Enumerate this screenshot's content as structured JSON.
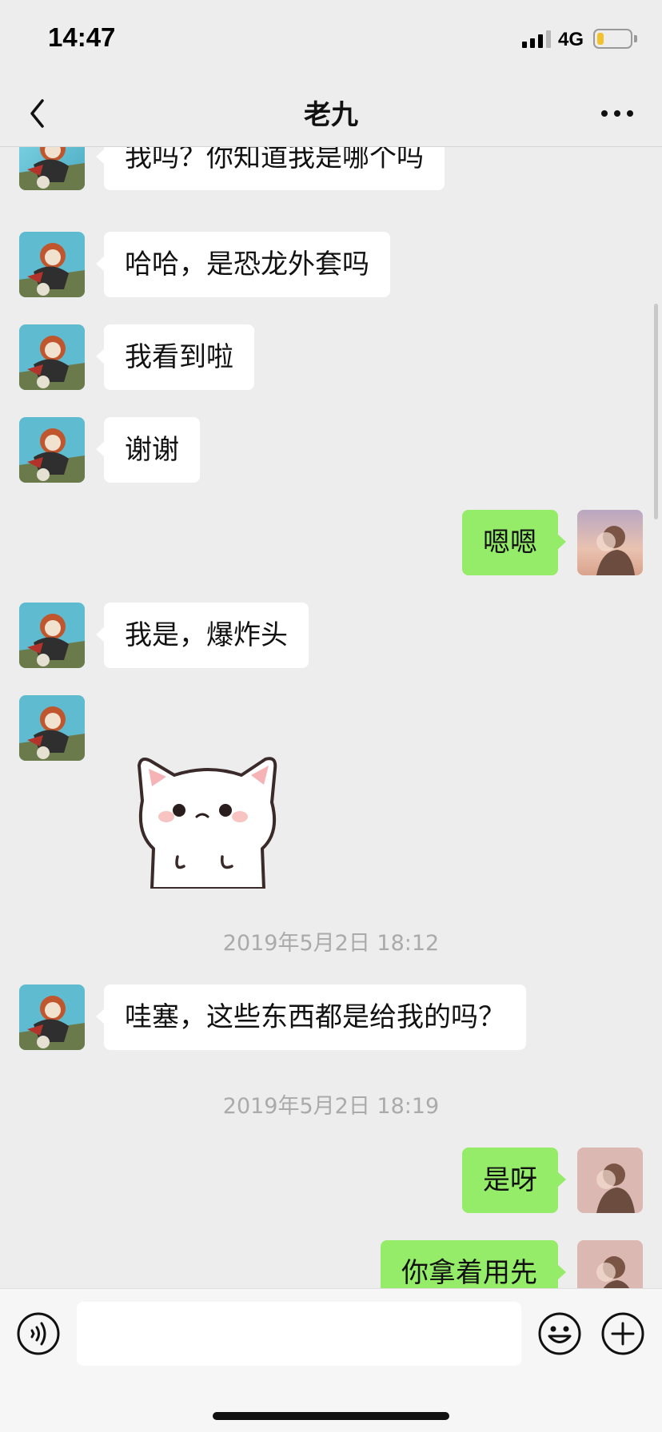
{
  "status_bar": {
    "time": "14:47",
    "network": "4G",
    "battery_level": 0.2,
    "battery_color": "#f2c22e"
  },
  "nav": {
    "title": "老九",
    "back_icon": "chevron-left-icon",
    "more_icon": "ellipsis-icon"
  },
  "colors": {
    "background": "#ededed",
    "incoming_bubble": "#ffffff",
    "outgoing_bubble": "#95ec69",
    "timestamp_text": "#aaaaaa"
  },
  "messages": [
    {
      "direction": "in",
      "text": "我吗？你知道我是哪个吗"
    },
    {
      "direction": "in",
      "text": "哈哈，是恐龙外套吗"
    },
    {
      "direction": "in",
      "text": "我看到啦"
    },
    {
      "direction": "in",
      "text": "谢谢"
    },
    {
      "direction": "out",
      "text": "嗯嗯"
    },
    {
      "direction": "in",
      "text": "我是，爆炸头"
    },
    {
      "direction": "in",
      "type": "sticker",
      "sticker": "white-cat-sticker"
    },
    {
      "type": "timestamp",
      "text": "2019年5月2日 18:12"
    },
    {
      "direction": "in",
      "text": "哇塞，这些东西都是给我的吗？"
    },
    {
      "type": "timestamp",
      "text": "2019年5月2日 18:19"
    },
    {
      "direction": "out",
      "text": "是呀"
    },
    {
      "direction": "out",
      "text": "你拿着用先"
    }
  ],
  "input_bar": {
    "voice_icon": "voice-icon",
    "input_value": "",
    "emoji_icon": "emoji-icon",
    "plus_icon": "plus-circle-icon"
  }
}
